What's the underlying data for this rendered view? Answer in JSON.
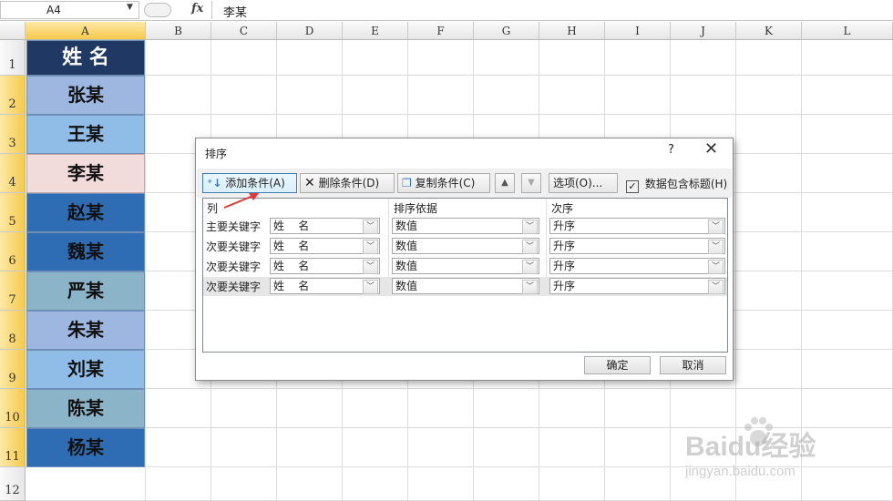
{
  "formula_bar": {
    "name_box": "A4",
    "fx_label": "fx",
    "value": "李某"
  },
  "columns": [
    "A",
    "B",
    "C",
    "D",
    "E",
    "F",
    "G",
    "H",
    "I",
    "J",
    "K",
    "L"
  ],
  "rows": [
    "1",
    "2",
    "3",
    "4",
    "5",
    "6",
    "7",
    "8",
    "9",
    "10",
    "11",
    "12"
  ],
  "cells": {
    "header": "姓  名",
    "names": [
      "张某",
      "王某",
      "李某",
      "赵某",
      "魏某",
      "严某",
      "朱某",
      "刘某",
      "陈某",
      "杨某"
    ]
  },
  "colors": {
    "header_bg": "#1f3864",
    "header_text": "#ffffff",
    "row_fills": [
      "#9db7e0",
      "#8fbde8",
      "#f2dcdb",
      "#2e6db4",
      "#2e6db4",
      "#8cb4c8",
      "#9db7e0",
      "#8fbde8",
      "#8cb4c8",
      "#2e6db4"
    ]
  },
  "dialog": {
    "title": "排序",
    "help": "?",
    "close": "✕",
    "toolbar": {
      "add": "添加条件(A)",
      "delete": "删除条件(D)",
      "copy": "复制条件(C)",
      "up": "▲",
      "down": "▼",
      "options": "选项(O)...",
      "has_header": "数据包含标题(H)",
      "has_header_checked": true
    },
    "columns_header": {
      "column": "列",
      "sort_on": "排序依据",
      "order": "次序"
    },
    "rules": [
      {
        "label": "主要关键字",
        "column": "姓    名",
        "sort_on": "数值",
        "order": "升序"
      },
      {
        "label": "次要关键字",
        "column": "姓    名",
        "sort_on": "数值",
        "order": "升序"
      },
      {
        "label": "次要关键字",
        "column": "姓    名",
        "sort_on": "数值",
        "order": "升序"
      },
      {
        "label": "次要关键字",
        "column": "姓    名",
        "sort_on": "数值",
        "order": "升序"
      }
    ],
    "ok": "确定",
    "cancel": "取消"
  },
  "watermark": {
    "brand": "Baidu经验",
    "url": "jingyan.baidu.com"
  }
}
